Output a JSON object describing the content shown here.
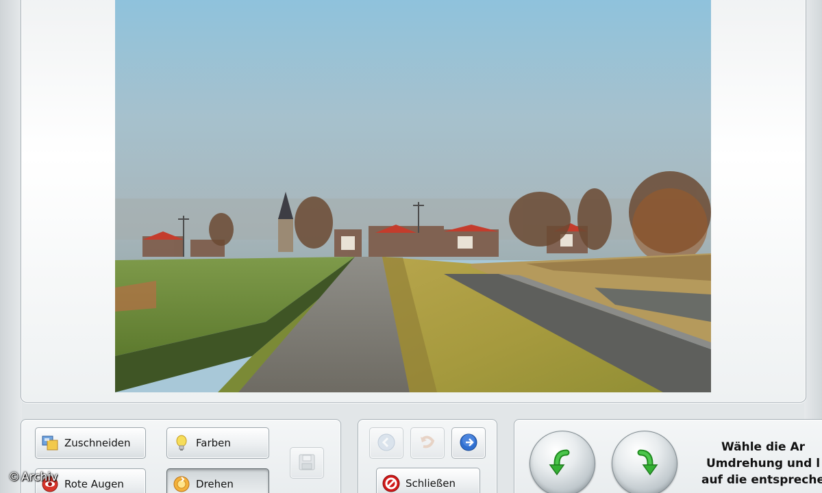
{
  "photo": {
    "description_icon": "landscape-photo"
  },
  "tools": {
    "crop": {
      "label": "Zuschneiden",
      "icon": "crop-icon"
    },
    "colors": {
      "label": "Farben",
      "icon": "lightbulb-icon"
    },
    "red_eye": {
      "label": "Rote Augen",
      "icon": "red-eye-icon"
    },
    "rotate": {
      "label": "Drehen",
      "icon": "rotate-icon"
    },
    "save": {
      "icon": "floppy-disk-icon"
    }
  },
  "navigation": {
    "back": {
      "icon": "arrow-left-circle-icon"
    },
    "undo": {
      "icon": "undo-icon"
    },
    "forward": {
      "icon": "arrow-right-circle-icon"
    },
    "close": {
      "label": "Schließen",
      "icon": "no-entry-icon"
    }
  },
  "rotation": {
    "rotate_left": {
      "icon": "rotate-counterclockwise-arrow-icon"
    },
    "rotate_right": {
      "icon": "rotate-clockwise-arrow-icon"
    },
    "instruction_line1": "Wähle die Ar",
    "instruction_line2": "Umdrehung und l",
    "instruction_line3": "auf die entspreche"
  },
  "watermark": {
    "symbol": "©",
    "text": "Archiv"
  },
  "colors": {
    "accent_blue": "#2f6fd0",
    "close_red": "#d01818",
    "rotate_green": "#2eaa2e"
  }
}
